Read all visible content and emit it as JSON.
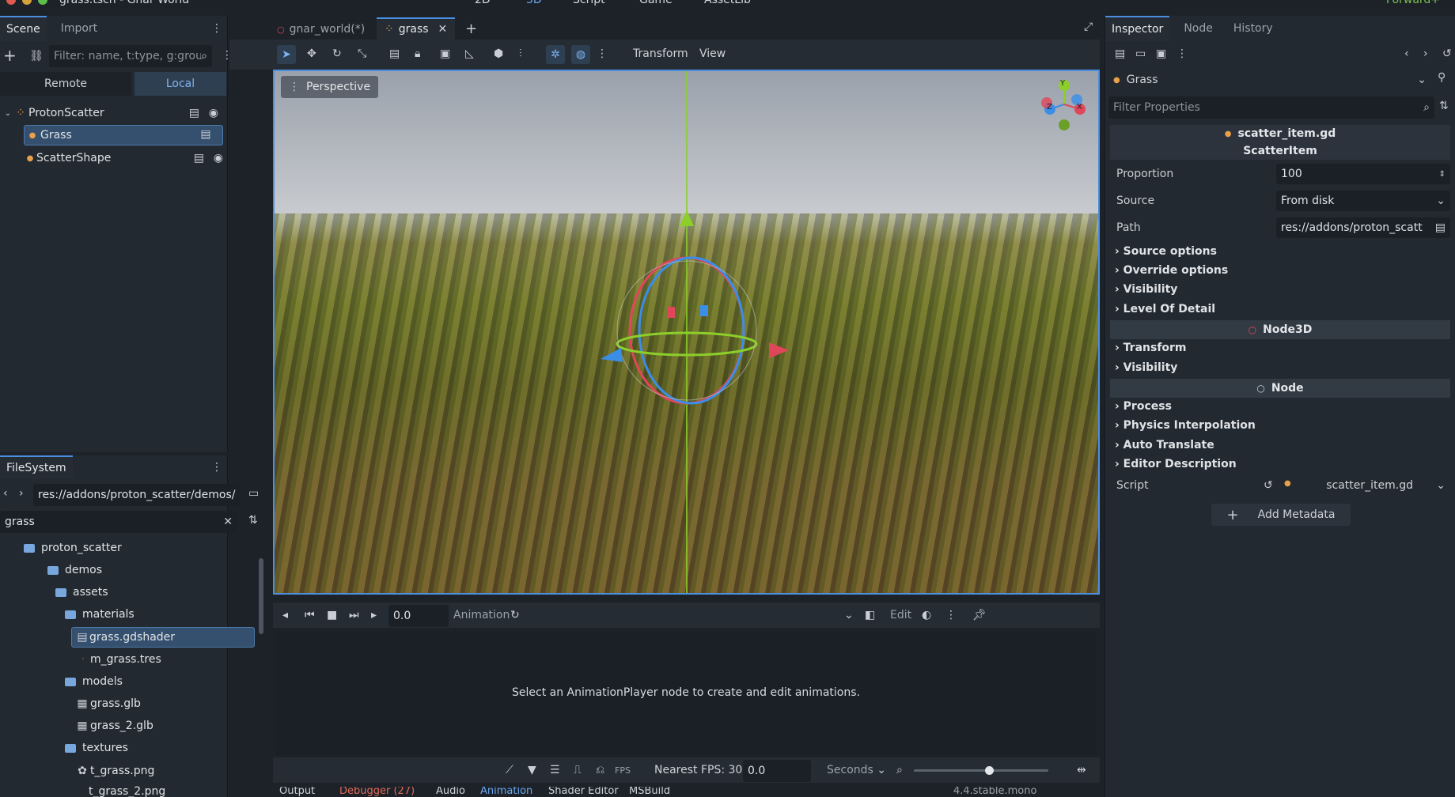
{
  "window": {
    "title": "grass.tscn - Gnar World"
  },
  "top_menu": {
    "mode_2d": "2D",
    "mode_3d": "3D",
    "script": "Script",
    "game": "Game",
    "assetlib": "AssetLib",
    "renderer": "Forward+"
  },
  "scene_panel": {
    "tabs": [
      "Scene",
      "Import"
    ],
    "filter_placeholder": "Filter: name, t:type, g:grou",
    "remote_label": "Remote",
    "local_label": "Local",
    "nodes": [
      {
        "label": "ProtonScatter"
      },
      {
        "label": "Grass"
      },
      {
        "label": "ScatterShape"
      }
    ]
  },
  "filesystem": {
    "title": "FileSystem",
    "path": "res://addons/proton_scatter/demos/a",
    "search": "grass",
    "items": [
      {
        "label": "proton_scatter",
        "type": "folder"
      },
      {
        "label": "demos",
        "type": "folder"
      },
      {
        "label": "assets",
        "type": "folder"
      },
      {
        "label": "materials",
        "type": "folder"
      },
      {
        "label": "grass.gdshader",
        "type": "file"
      },
      {
        "label": "m_grass.tres",
        "type": "file"
      },
      {
        "label": "models",
        "type": "folder"
      },
      {
        "label": "grass.glb",
        "type": "file"
      },
      {
        "label": "grass_2.glb",
        "type": "file"
      },
      {
        "label": "textures",
        "type": "folder"
      },
      {
        "label": "t_grass.png",
        "type": "file"
      },
      {
        "label": "t_grass_2.png",
        "type": "file"
      }
    ]
  },
  "editor_tabs": [
    {
      "label": "gnar_world(*)"
    },
    {
      "label": "grass"
    }
  ],
  "toolbar3d": {
    "transform": "Transform",
    "view": "View"
  },
  "viewport": {
    "perspective": "Perspective",
    "gizmo_x": "X",
    "gizmo_y": "Y",
    "gizmo_z": "Z"
  },
  "animation": {
    "time": "0.0",
    "label": "Animation",
    "edit": "Edit",
    "message": "Select an AnimationPlayer node to create and edit animations.",
    "fps_label": "Nearest FPS: 30",
    "step": "0.0",
    "unit": "Seconds"
  },
  "bottom_tabs": [
    "Output",
    "Debugger (27)",
    "Audio",
    "Animation",
    "Shader Editor",
    "MSBuild"
  ],
  "version": "4.4.stable.mono",
  "inspector": {
    "tabs": [
      "Inspector",
      "Node",
      "History"
    ],
    "object": "Grass",
    "filter_placeholder": "Filter Properties",
    "script_file": "scatter_item.gd",
    "class_name": "ScatterItem",
    "props": {
      "proportion_label": "Proportion",
      "proportion_value": "100",
      "source_label": "Source",
      "source_value": "From disk",
      "path_label": "Path",
      "path_value": "res://addons/proton_scatt"
    },
    "groups_scatter": [
      "Source options",
      "Override options",
      "Visibility",
      "Level Of Detail"
    ],
    "node3d_header": "Node3D",
    "groups_node3d": [
      "Transform",
      "Visibility"
    ],
    "node_header": "Node",
    "groups_node": [
      "Process",
      "Physics Interpolation",
      "Auto Translate",
      "Editor Description"
    ],
    "script_label": "Script",
    "script_value": "scatter_item.gd",
    "add_metadata": "Add Metadata"
  },
  "colors": {
    "accent": "#4b8fe0",
    "x_axis": "#e0465a",
    "y_axis": "#8ccf2a",
    "z_axis": "#3a8ee8"
  }
}
